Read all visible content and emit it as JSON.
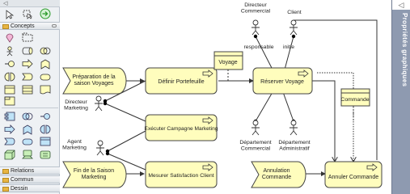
{
  "palette": {
    "collapse_glyph": "◁",
    "sections": {
      "concepts": "Concepts",
      "relations": "Relations",
      "commun": "Commun",
      "dessin": "Dessin"
    },
    "tools": [
      "select-arrow-icon",
      "marquee-select-icon",
      "connect-icon",
      "location-pin-icon",
      "grouping-icon",
      "actor-icon",
      "role-icon",
      "collaboration-icon",
      "interface-icon",
      "process-icon",
      "function-icon",
      "interaction-icon",
      "event-icon",
      "service-icon",
      "object-icon",
      "contract-icon",
      "representation-icon",
      "product-icon",
      "app-component-icon",
      "app-collab-icon",
      "app-interface-icon",
      "app-function-icon",
      "app-interaction-icon",
      "app-process-icon",
      "app-event-icon",
      "app-service-icon",
      "data-object-icon",
      "node-icon",
      "device-icon",
      "network-icon"
    ]
  },
  "right_panel": {
    "collapse_glyph": "◁",
    "title": "Propriétés graphiques"
  },
  "diagram": {
    "actors": {
      "directeur_commercial": "Directeur\nCommercial",
      "client": "Client",
      "directeur_marketing": "Directeur\nMarketing",
      "agent_marketing": "Agent\nMarketing",
      "departement_commercial": "Département\nCommercial",
      "departement_administratif": "Département\nAdministratif"
    },
    "roles": {
      "responsable": "responsable",
      "initie": "initie"
    },
    "events": {
      "preparation": "Préparation de la\nsaison Voyages",
      "fin_saison": "Fin de la Saison\nMarketing",
      "annulation": "Annulation\nCommande"
    },
    "processes": {
      "definir": "Définir Portefeuille",
      "reserver": "Réserver Voyage",
      "executer": "Exécuter Campagne Marketing",
      "mesurer": "Mesurer Satisfaction Client",
      "annuler": "Annuler Commande"
    },
    "objects": {
      "voyage": "Voyage",
      "commande": "Commande"
    }
  },
  "colors": {
    "element_fill": "#fffdbd",
    "element_stroke": "#444444",
    "panel": "#8e9ab0"
  }
}
